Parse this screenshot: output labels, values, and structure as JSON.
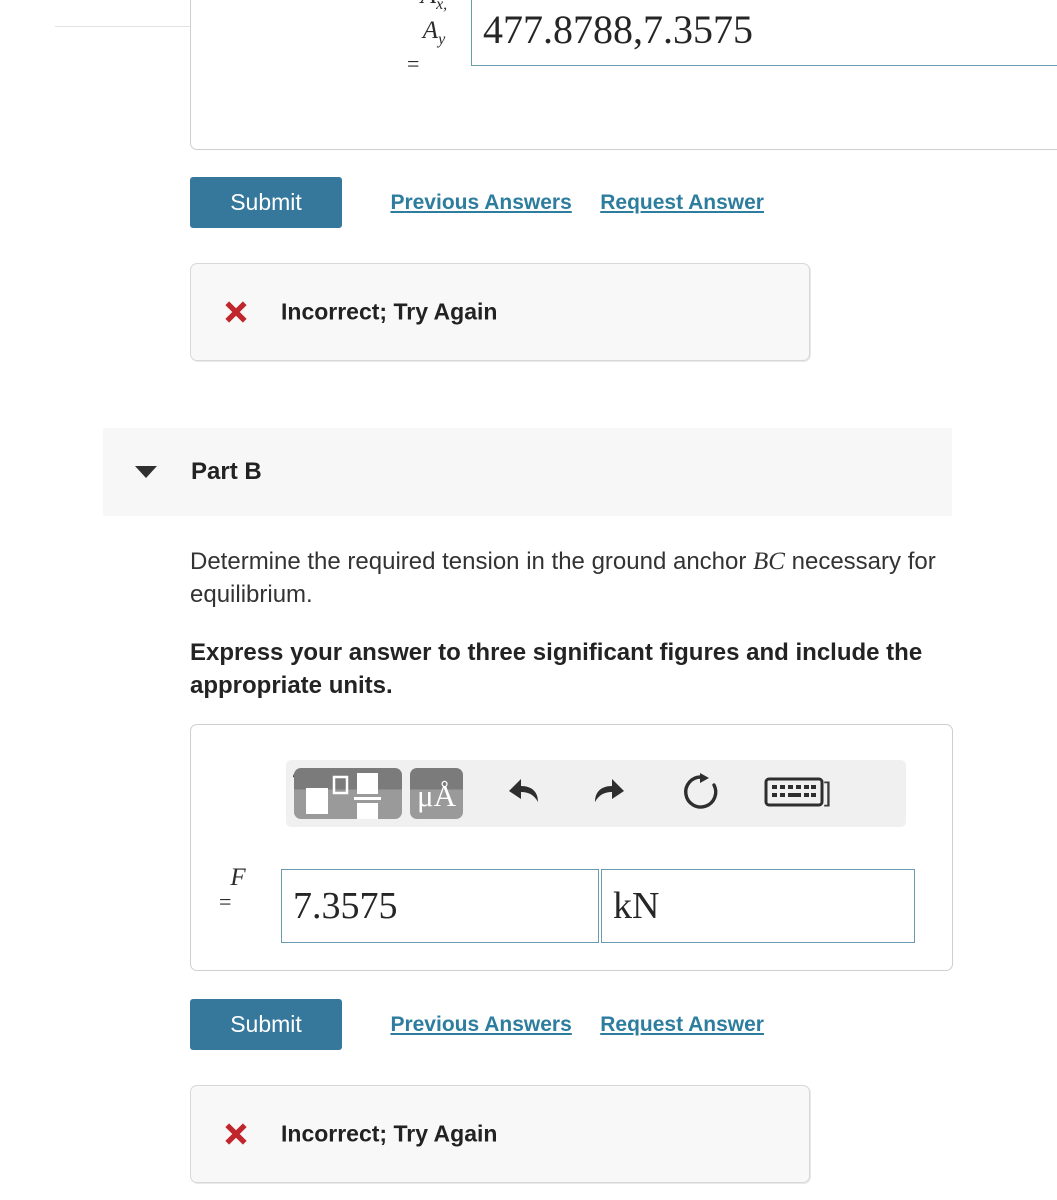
{
  "colors": {
    "submit_button": "#36789c",
    "link": "#2d7d9e",
    "error_mark": "#c0272d",
    "input_border": "#6a9ab0",
    "panel_background": "#f7f7f7"
  },
  "part_a": {
    "variable_label_1": "A",
    "variable_label_1_sub": "x,",
    "variable_label_2": "A",
    "variable_label_2_sub": "y",
    "equals": "=",
    "answer_value": "477.8788,7.3575",
    "actions": {
      "submit_label": "Submit",
      "previous_answers_label": "Previous Answers",
      "request_answer_label": "Request Answer"
    },
    "feedback": {
      "icon": "red-x-icon",
      "text": "Incorrect; Try Again"
    }
  },
  "part_b": {
    "caret_icon": "caret-down-icon",
    "title": "Part B",
    "prompt_text_before": "Determine the required tension in the ground anchor ",
    "prompt_math": "BC",
    "prompt_text_after": " necessary for equilibrium.",
    "instruction": "Express your answer to three significant figures and include the appropriate units.",
    "toolbar": {
      "template_button": "math-template-icon",
      "units_button": "μÅ",
      "undo_icon": "undo-arrow-icon",
      "redo_icon": "redo-arrow-icon",
      "reset_icon": "reset-circular-arrow-icon",
      "keyboard_icon": "keyboard-icon",
      "keyboard_bracket": "]",
      "help_icon": "?"
    },
    "variable_label": "F",
    "equals": "=",
    "answer_value": "7.3575",
    "answer_units": "kN",
    "actions": {
      "submit_label": "Submit",
      "previous_answers_label": "Previous Answers",
      "request_answer_label": "Request Answer"
    },
    "feedback": {
      "icon": "red-x-icon",
      "text": "Incorrect; Try Again"
    }
  }
}
